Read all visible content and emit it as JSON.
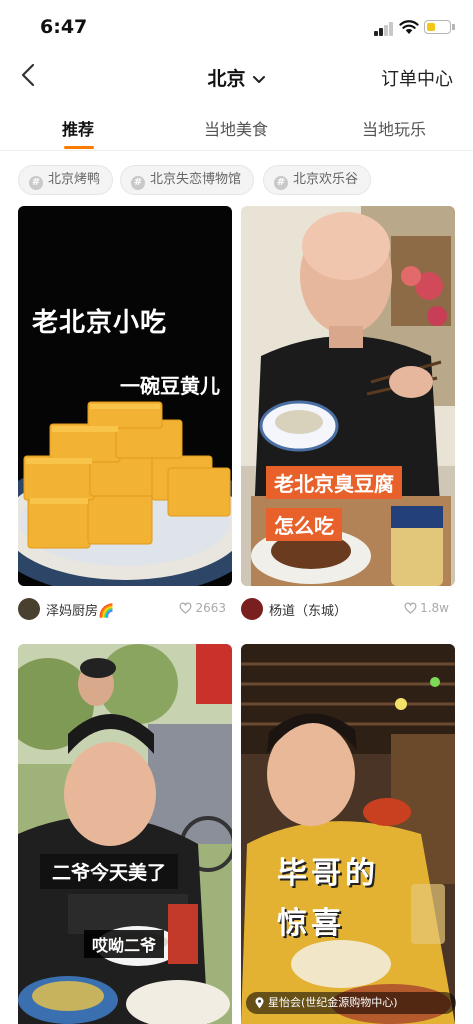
{
  "status_bar": {
    "time": "6:47",
    "battery_color": "#f5c518"
  },
  "nav": {
    "title": "北京",
    "orders_label": "订单中心"
  },
  "tabs": [
    {
      "label": "推荐",
      "active": true
    },
    {
      "label": "当地美食",
      "active": false
    },
    {
      "label": "当地玩乐",
      "active": false
    }
  ],
  "tags": [
    "北京烤鸭",
    "北京失恋博物馆",
    "北京欢乐谷"
  ],
  "cards": [
    {
      "overlay_title": "老北京小吃",
      "overlay_subtitle": "一碗豆黄儿",
      "author": "泽妈厨房🌈",
      "likes": "2663"
    },
    {
      "overlay_title": "老北京臭豆腐",
      "overlay_subtitle": "怎么吃",
      "author": "杨道（东城）",
      "likes": "1.8w"
    },
    {
      "overlay_title": "二爷今天美了",
      "overlay_subtitle": "哎呦二爷"
    },
    {
      "overlay_title": "毕哥的",
      "overlay_subtitle": "惊喜",
      "location": "星怡会(世纪金源购物中心)"
    }
  ],
  "colors": {
    "accent": "#ff7a00",
    "overlay_box": "#e8612a",
    "text_dark": "#111111"
  },
  "icons": [
    "back-arrow-icon",
    "chevron-down-icon",
    "hashtag-icon",
    "heart-icon",
    "location-pin-icon"
  ]
}
